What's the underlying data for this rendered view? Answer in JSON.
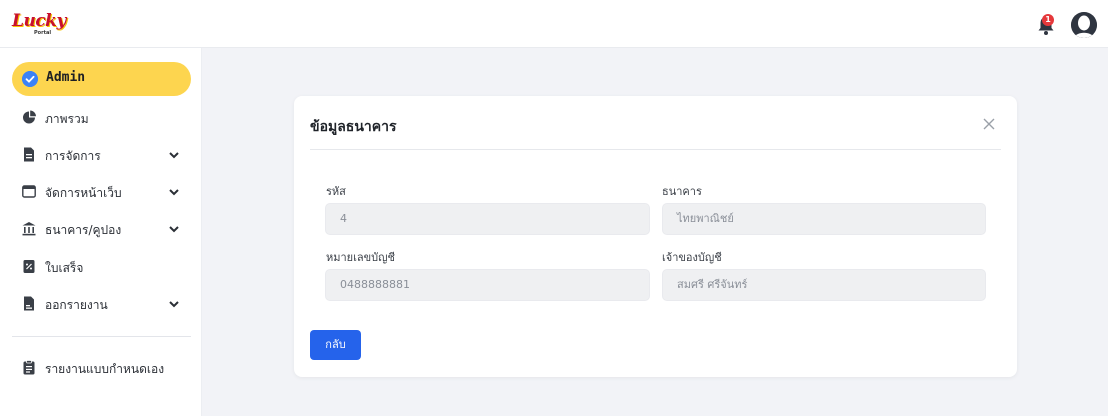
{
  "brand": {
    "logo_text": "Lucky",
    "logo_sub": "Portal"
  },
  "header": {
    "notification_count": "1"
  },
  "sidebar": {
    "active": {
      "label": "Admin"
    },
    "items": [
      {
        "label": "ภาพรวม",
        "icon": "pie-chart-icon",
        "has_submenu": false
      },
      {
        "label": "การจัดการ",
        "icon": "document-icon",
        "has_submenu": true
      },
      {
        "label": "จัดการหน้าเว็บ",
        "icon": "browser-window-icon",
        "has_submenu": true
      },
      {
        "label": "ธนาคาร/คูปอง",
        "icon": "bank-icon",
        "has_submenu": true
      },
      {
        "label": "ใบเสร็จ",
        "icon": "receipt-icon",
        "has_submenu": false
      },
      {
        "label": "ออกรายงาน",
        "icon": "report-file-icon",
        "has_submenu": true
      },
      {
        "label": "รายงานแบบกำหนดเอง",
        "icon": "clipboard-icon",
        "has_submenu": false
      }
    ]
  },
  "card": {
    "title": "ข้อมูลธนาคาร",
    "fields": {
      "code_label": "รหัส",
      "code_value": "4",
      "bank_label": "ธนาคาร",
      "bank_value": "ไทยพาณิชย์",
      "account_no_label": "หมายเลขบัญชี",
      "account_no_value": "0488888881",
      "owner_label": "เจ้าของบัญชี",
      "owner_value": "สมศรี ศรีจันทร์"
    },
    "back_label": "กลับ"
  },
  "colors": {
    "accent_yellow": "#fdd54f",
    "primary_blue": "#2563eb",
    "badge_red": "#e5383b"
  }
}
